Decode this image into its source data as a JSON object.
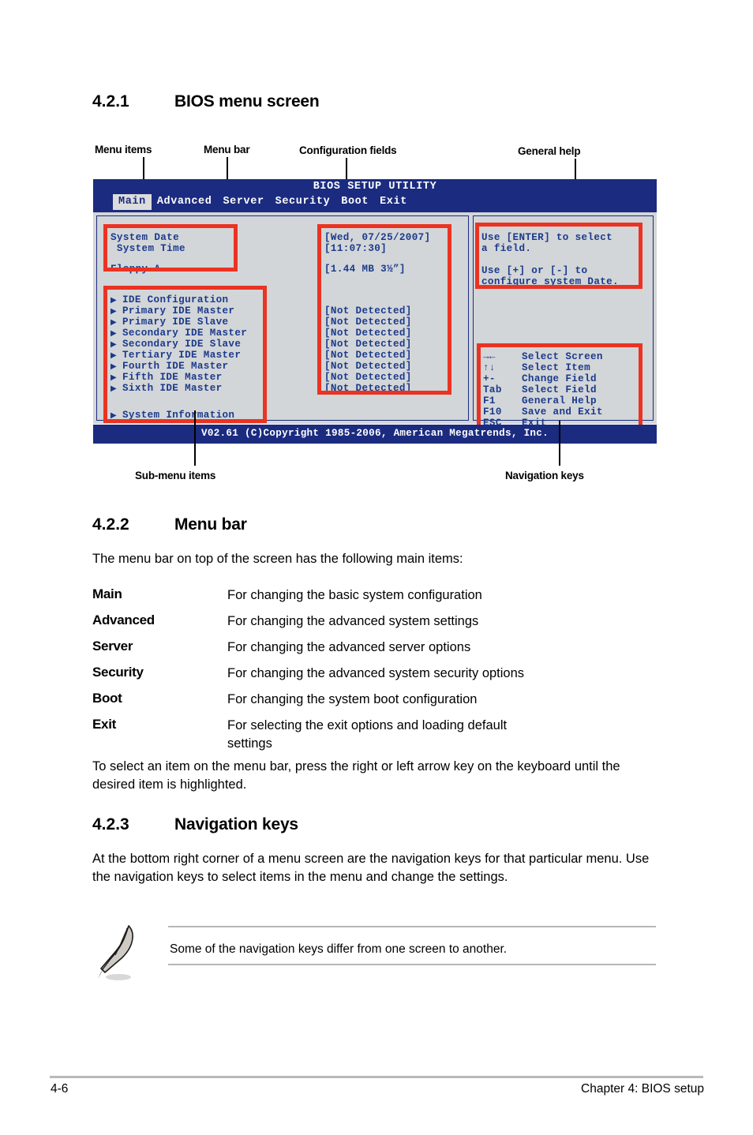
{
  "sections": {
    "s421": {
      "number": "4.2.1",
      "title": "BIOS menu screen"
    },
    "s422": {
      "number": "4.2.2",
      "title": "Menu bar"
    },
    "s423": {
      "number": "4.2.3",
      "title": "Navigation keys"
    }
  },
  "callouts": {
    "menu_items": "Menu items",
    "menu_bar": "Menu bar",
    "configuration_fields": "Configuration fields",
    "general_help": "General help",
    "sub_menu_items": "Sub-menu items",
    "navigation_keys": "Navigation keys"
  },
  "bios": {
    "title": "BIOS SETUP UTILITY",
    "tabs": [
      {
        "label": "Main",
        "active": true
      },
      {
        "label": "Advanced",
        "active": false
      },
      {
        "label": "Server",
        "active": false
      },
      {
        "label": "Security",
        "active": false
      },
      {
        "label": "Boot",
        "active": false
      },
      {
        "label": "Exit",
        "active": false
      }
    ],
    "left_items_top": [
      "System Date",
      " System Time"
    ],
    "left_item_floppy": "Floppy A",
    "submenu_items": [
      "IDE Configuration",
      "Primary IDE Master",
      "Primary IDE Slave",
      "Secondary IDE Master",
      "Secondary IDE Slave",
      "Tertiary IDE Master",
      "Fourth IDE Master",
      "Fifth IDE Master",
      "Sixth IDE Master"
    ],
    "system_information": "System Information",
    "values_top": [
      "[Wed, 07/25/2007]",
      "[11:07:30]"
    ],
    "value_floppy": "[1.44 MB 3½”]",
    "values_detected": [
      "[Not Detected]",
      "[Not Detected]",
      "[Not Detected]",
      "[Not Detected]",
      "[Not Detected]",
      "[Not Detected]",
      "[Not Detected]",
      "[Not Detected]"
    ],
    "help_lines": [
      "Use [ENTER] to select",
      "a field.",
      "",
      "Use [+] or [-] to",
      "configure system Date."
    ],
    "nav_keys": [
      {
        "key": "→←",
        "action": "Select Screen"
      },
      {
        "key": "↑↓",
        "action": "Select Item"
      },
      {
        "key": "+-",
        "action": "Change Field"
      },
      {
        "key": "Tab",
        "action": "Select Field"
      },
      {
        "key": "F1",
        "action": "General Help"
      },
      {
        "key": "F10",
        "action": "Save and Exit"
      },
      {
        "key": "ESC",
        "action": "Exit"
      }
    ],
    "copyright": "V02.61 (C)Copyright 1985-2006, American Megatrends, Inc.",
    "colors": {
      "header_blue": "#1b2b80",
      "body_gray": "#d3d6d8",
      "text_blue": "#1b3a8c",
      "highlight_red": "#ea3323",
      "active_tab_bg": "#dcdcdc"
    }
  },
  "menu_bar_section": {
    "intro": "The menu bar on top of the screen has the following main items:",
    "entries": [
      {
        "term": "Main",
        "definition": "For changing the basic system configuration"
      },
      {
        "term": "Advanced",
        "definition": "For changing the advanced system settings"
      },
      {
        "term": "Server",
        "definition": "For changing the advanced server options"
      },
      {
        "term": "Security",
        "definition": "For changing the advanced system security options"
      },
      {
        "term": "Boot",
        "definition": "For changing the system boot configuration"
      },
      {
        "term": "Exit",
        "definition": "For selecting the exit options and loading default settings"
      }
    ],
    "outro": "To select an item on the menu bar, press the right or left arrow key on the keyboard until the desired item is highlighted."
  },
  "navigation_keys_section": {
    "body": "At the bottom right corner of a menu screen are the navigation keys for that particular menu. Use the navigation keys to select items in the menu and change the settings.",
    "note": "Some of the navigation keys differ from one screen to another."
  },
  "footer": {
    "page": "4-6",
    "chapter": "Chapter 4: BIOS setup"
  }
}
